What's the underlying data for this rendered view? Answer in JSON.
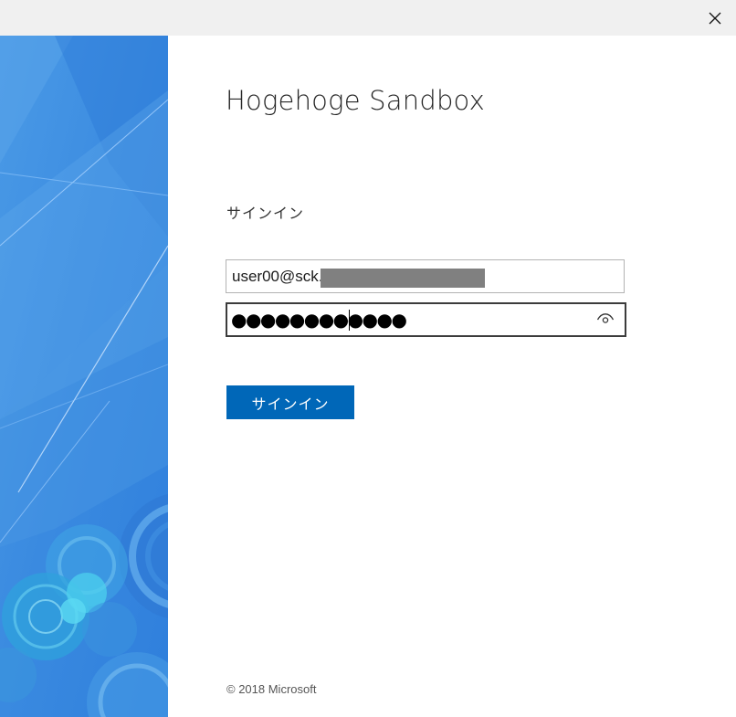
{
  "window": {
    "close_label": "×"
  },
  "main": {
    "app_title": "Hogehoge Sandbox",
    "signin_heading": "サインイン",
    "email": {
      "value": "user00@sck."
    },
    "password": {
      "masked_value": "●●●●●●●●●●●●"
    },
    "signin_button_label": "サインイン",
    "footer": "© 2018 Microsoft"
  },
  "icons": {
    "close": "close-icon",
    "reveal_password": "eye-icon"
  },
  "colors": {
    "accent": "#0067b8",
    "panel_blue": "#3e8de0",
    "titlebar": "#f0f0f0"
  }
}
